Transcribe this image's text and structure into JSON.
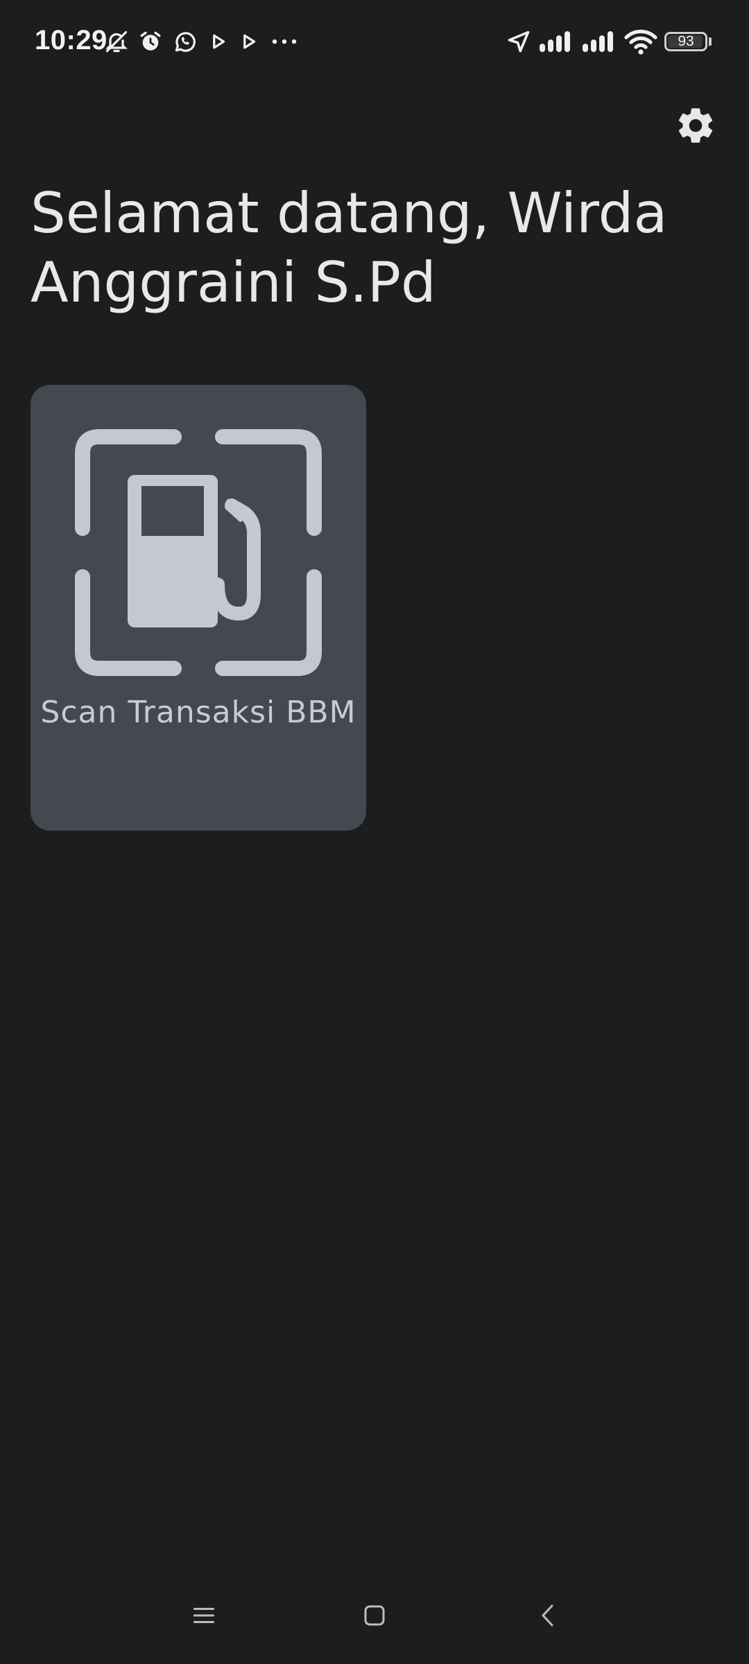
{
  "status_bar": {
    "time": "10:29",
    "battery_level": "93",
    "left_icons": [
      "bell-off-icon",
      "alarm-icon",
      "whatsapp-icon",
      "play-icon",
      "play-icon",
      "more-dots-icon"
    ],
    "right_icons": [
      "location-arrow-icon",
      "signal-icon",
      "signal-icon",
      "wifi-icon",
      "battery-icon"
    ]
  },
  "header": {
    "settings_icon": "gear-icon"
  },
  "greeting": {
    "text": "Selamat datang, Wirda Anggraini S.Pd"
  },
  "menu": {
    "items": [
      {
        "label": "Scan Transaksi BBM",
        "icon": "fuel-scan-icon"
      }
    ]
  },
  "nav_bar": {
    "buttons": [
      "menu-icon",
      "home-icon",
      "back-icon"
    ]
  },
  "colors": {
    "background": "#1c1d1f",
    "card": "#454850",
    "icon": "#c6c8d0",
    "text": "#e8e8ea"
  }
}
